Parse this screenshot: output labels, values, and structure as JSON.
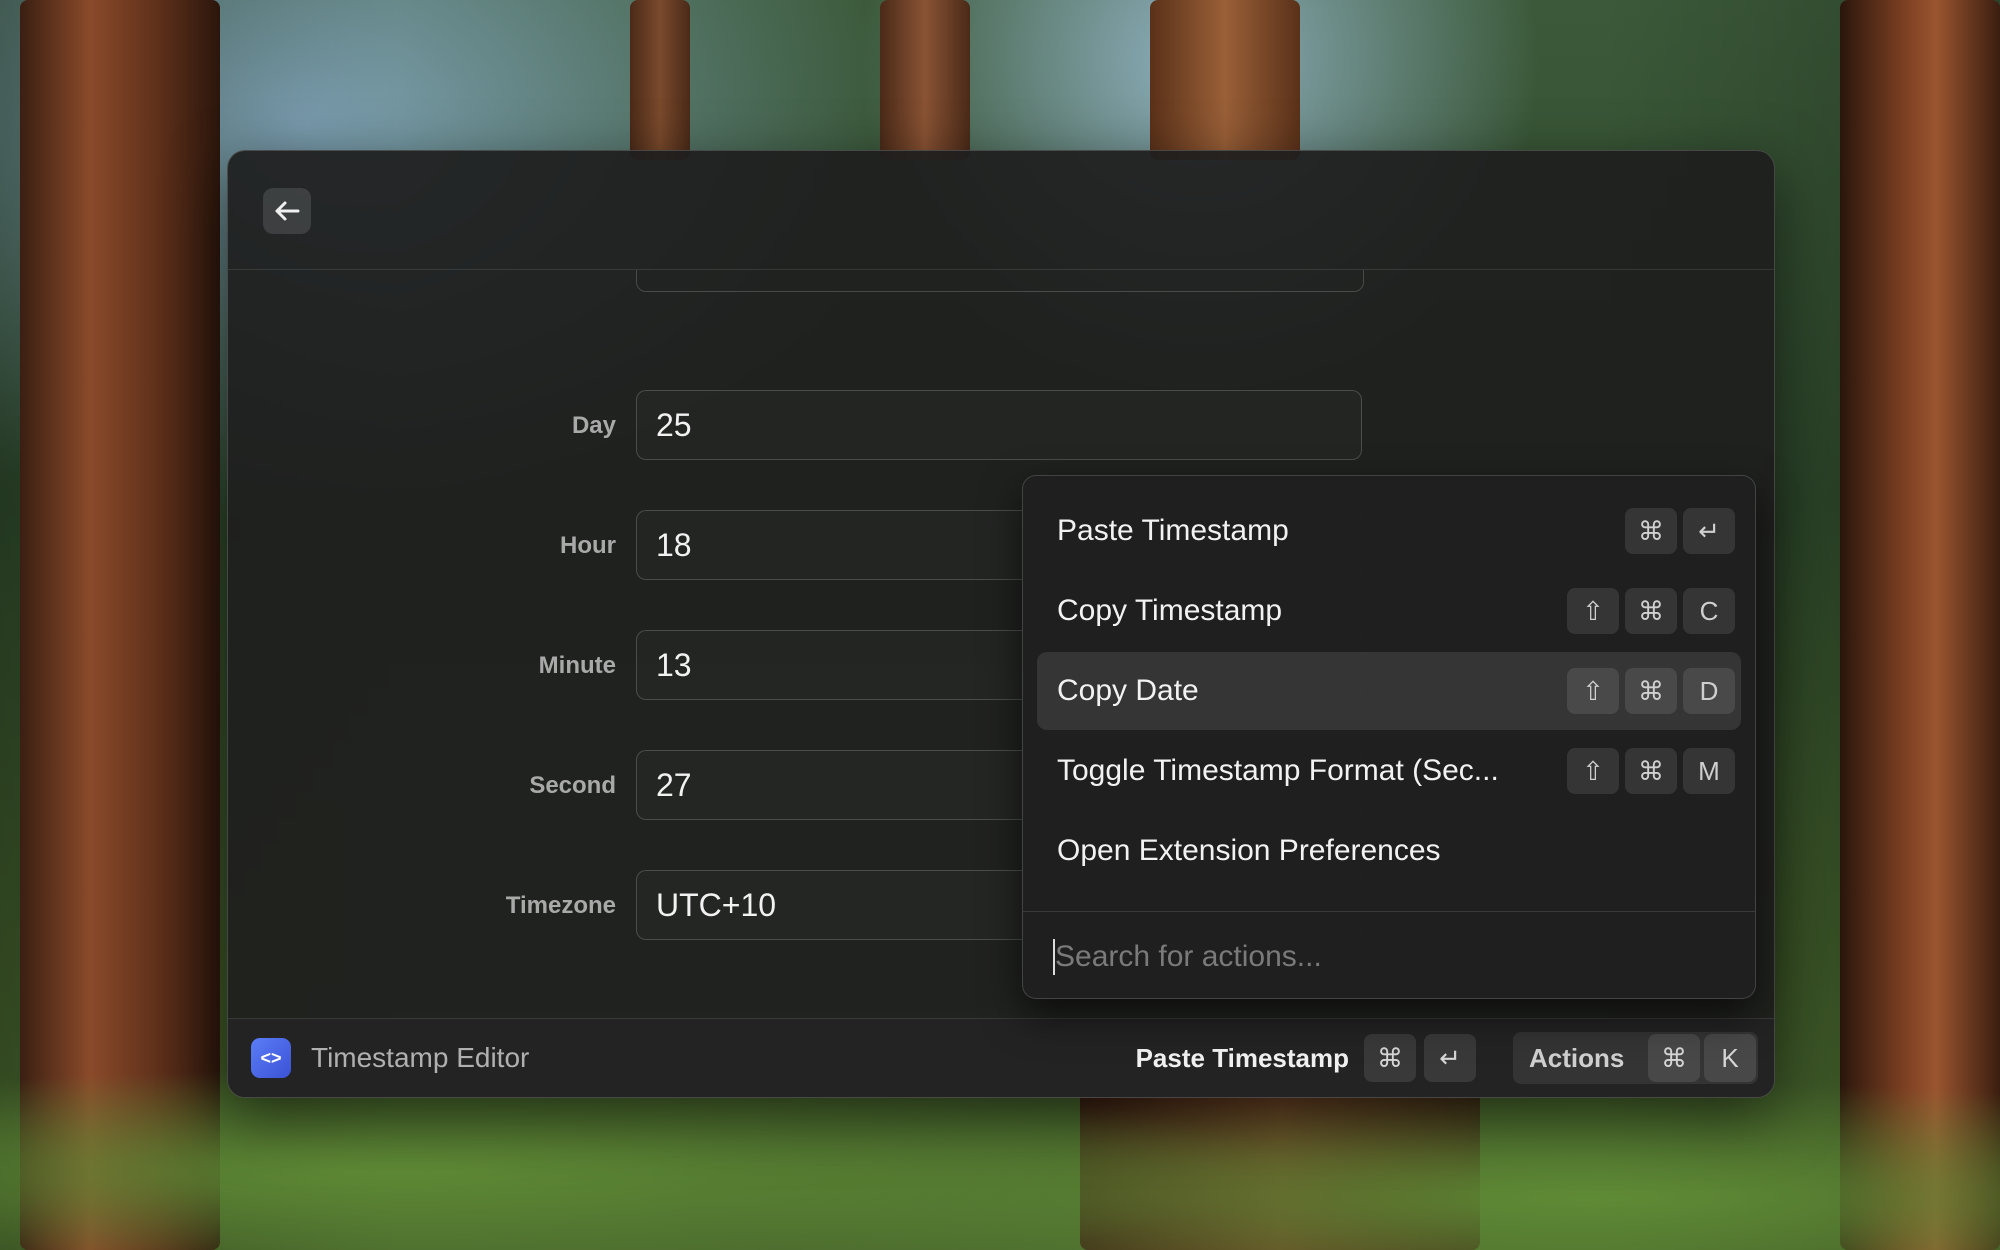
{
  "window": {
    "back_label": "←",
    "fields": [
      {
        "label": "Day",
        "value": "25"
      },
      {
        "label": "Hour",
        "value": "18"
      },
      {
        "label": "Minute",
        "value": "13"
      },
      {
        "label": "Second",
        "value": "27"
      },
      {
        "label": "Timezone",
        "value": "UTC+10"
      }
    ]
  },
  "menu": {
    "items": [
      {
        "label": "Paste Timestamp",
        "keys": [
          "⌘",
          "↵"
        ]
      },
      {
        "label": "Copy Timestamp",
        "keys": [
          "⇧",
          "⌘",
          "C"
        ]
      },
      {
        "label": "Copy Date",
        "keys": [
          "⇧",
          "⌘",
          "D"
        ],
        "selected": true
      },
      {
        "label": "Toggle Timestamp Format (Sec...",
        "keys": [
          "⇧",
          "⌘",
          "M"
        ]
      },
      {
        "label": "Open Extension Preferences",
        "keys": []
      }
    ],
    "search_placeholder": "Search for actions..."
  },
  "footer": {
    "icon_glyph": "<>",
    "title": "Timestamp Editor",
    "primary_action": "Paste Timestamp",
    "primary_keys": [
      "⌘",
      "↵"
    ],
    "actions_label": "Actions",
    "actions_keys": [
      "⌘",
      "K"
    ]
  },
  "colors": {
    "accent": "#4a66e8",
    "window_bg": "#1e1e1e",
    "text": "#f2f2f2",
    "label": "#a9a9a9"
  },
  "icons": {
    "back": "arrow-left-icon",
    "extension": "code-brackets-icon"
  }
}
